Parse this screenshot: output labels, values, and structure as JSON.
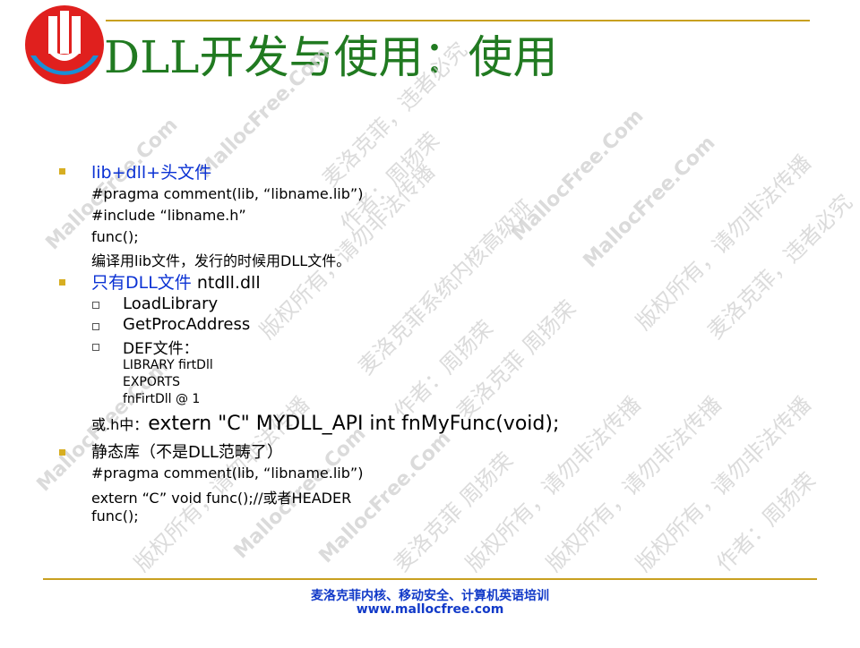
{
  "slide": {
    "title": "DLL开发与使用：使用"
  },
  "content": {
    "item1": {
      "heading": "lib+dll+头文件",
      "lines": [
        "#pragma comment(lib, “libname.lib”)",
        "#include “libname.h”",
        "func();",
        "编译用lib文件，发行的时候用DLL文件。"
      ]
    },
    "item2": {
      "heading_blue": "只有DLL文件",
      "heading_black": " ntdll.dll",
      "subitems": [
        "LoadLibrary",
        "GetProcAddress",
        "DEF文件："
      ],
      "def_lines": [
        "LIBRARY firtDll",
        "EXPORTS",
        "fnFirtDll @ 1"
      ],
      "note_prefix": "或.h中：",
      "note_code": "extern \"C\"  MYDLL_API int fnMyFunc(void);"
    },
    "item3": {
      "heading": "静态库（不是DLL范畴了）",
      "lines": [
        "#pragma comment(lib, “libname.lib”)",
        "extern “C” void func();//或者HEADER",
        "func();"
      ]
    }
  },
  "watermarks": [
    "MallocFree.Com",
    "麦洛克菲 周扬荣",
    "麦洛克菲，违者必究",
    "版权所有，请勿非法传播",
    "作者：周扬荣",
    "麦洛克菲系统内核高级班"
  ],
  "footer": {
    "line1": "麦洛克菲内核、移动安全、计算机英语培训",
    "line2": "www.mallocfree.com"
  },
  "colors": {
    "title": "#217a21",
    "bullet": "#d7ae22",
    "heading": "#0b32d4",
    "rule": "#c8a020",
    "footer": "#123ac8",
    "logo_red": "#e0201e",
    "logo_blue": "#1a8fd6"
  }
}
